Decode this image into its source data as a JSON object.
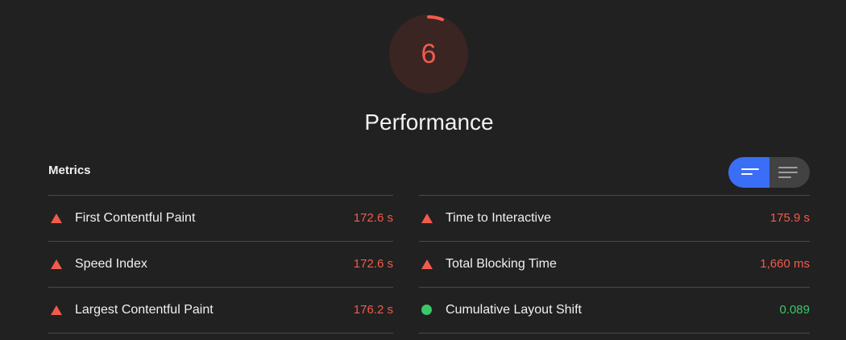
{
  "score": {
    "value": "6",
    "fraction": 0.06,
    "color": "#f15b4c"
  },
  "category": {
    "title": "Performance"
  },
  "metrics": {
    "title": "Metrics",
    "toggle": {
      "options": [
        {
          "name": "bars-view-icon",
          "active": true
        },
        {
          "name": "list-view-icon",
          "active": false
        }
      ],
      "accent": "#3b6ef6"
    },
    "left": [
      {
        "label": "First Contentful Paint",
        "value": "172.6 s",
        "status": "fail"
      },
      {
        "label": "Speed Index",
        "value": "172.6 s",
        "status": "fail"
      },
      {
        "label": "Largest Contentful Paint",
        "value": "176.2 s",
        "status": "fail"
      }
    ],
    "right": [
      {
        "label": "Time to Interactive",
        "value": "175.9 s",
        "status": "fail"
      },
      {
        "label": "Total Blocking Time",
        "value": "1,660 ms",
        "status": "fail"
      },
      {
        "label": "Cumulative Layout Shift",
        "value": "0.089",
        "status": "pass"
      }
    ]
  },
  "colors": {
    "fail": "#f15b4c",
    "pass": "#3cc769",
    "background": "#212121"
  }
}
